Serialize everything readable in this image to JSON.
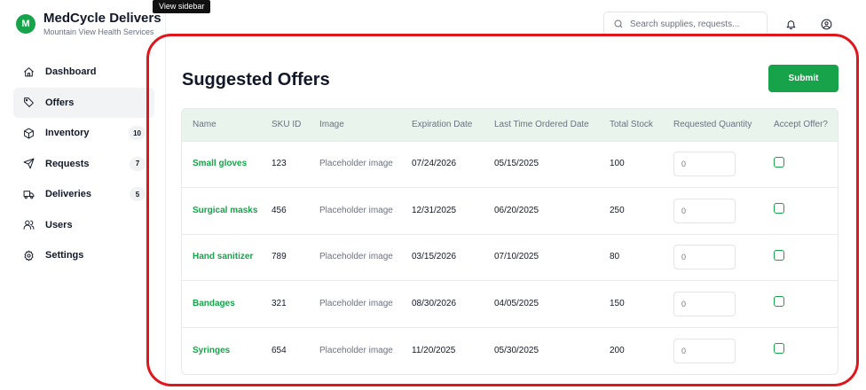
{
  "brand": {
    "avatar": "M",
    "title": "MedCycle Delivers",
    "subtitle": "Mountain View Health Services"
  },
  "tooltip": "View sidebar",
  "sidebar": {
    "items": [
      {
        "label": "Dashboard",
        "icon": "home-icon",
        "badge": ""
      },
      {
        "label": "Offers",
        "icon": "tag-icon",
        "badge": "",
        "active": true
      },
      {
        "label": "Inventory",
        "icon": "box-icon",
        "badge": "10"
      },
      {
        "label": "Requests",
        "icon": "send-icon",
        "badge": "7"
      },
      {
        "label": "Deliveries",
        "icon": "truck-icon",
        "badge": "5"
      },
      {
        "label": "Users",
        "icon": "users-icon",
        "badge": ""
      },
      {
        "label": "Settings",
        "icon": "gear-icon",
        "badge": ""
      }
    ]
  },
  "header": {
    "search_placeholder": "Search supplies, requests..."
  },
  "main": {
    "title": "Suggested Offers",
    "submit_label": "Submit",
    "columns": [
      "Name",
      "SKU ID",
      "Image",
      "Expiration Date",
      "Last Time Ordered Date",
      "Total Stock",
      "Requested Quantity",
      "Accept Offer?"
    ],
    "rows": [
      {
        "name": "Small gloves",
        "sku": "123",
        "image": "Placeholder image",
        "expiration": "07/24/2026",
        "last_ordered": "05/15/2025",
        "stock": "100",
        "qty": "0"
      },
      {
        "name": "Surgical masks",
        "sku": "456",
        "image": "Placeholder image",
        "expiration": "12/31/2025",
        "last_ordered": "06/20/2025",
        "stock": "250",
        "qty": "0"
      },
      {
        "name": "Hand sanitizer",
        "sku": "789",
        "image": "Placeholder image",
        "expiration": "03/15/2026",
        "last_ordered": "07/10/2025",
        "stock": "80",
        "qty": "0"
      },
      {
        "name": "Bandages",
        "sku": "321",
        "image": "Placeholder image",
        "expiration": "08/30/2026",
        "last_ordered": "04/05/2025",
        "stock": "150",
        "qty": "0"
      },
      {
        "name": "Syringes",
        "sku": "654",
        "image": "Placeholder image",
        "expiration": "11/20/2025",
        "last_ordered": "05/30/2025",
        "stock": "200",
        "qty": "0"
      }
    ]
  },
  "colors": {
    "accent": "#16a34a",
    "header_bg": "#e9f4ec",
    "annotation": "#e0161c"
  }
}
